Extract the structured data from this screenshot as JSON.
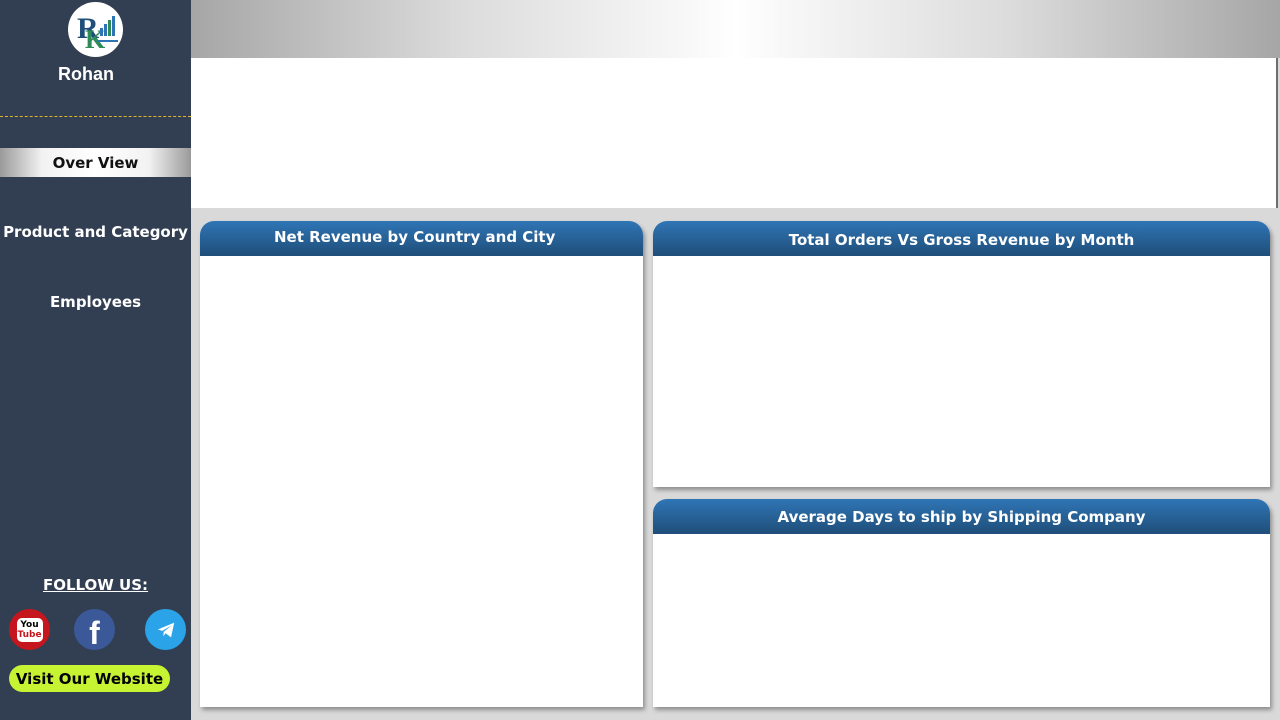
{
  "sidebar": {
    "user_name": "Rohan",
    "logo_icon": "rk-logo-icon",
    "nav": {
      "active": "Over View",
      "items": [
        "Product and Category",
        "Employees"
      ]
    },
    "follow_label": "FOLLOW US:",
    "social": {
      "youtube_line1": "You",
      "youtube_line2": "Tube",
      "facebook_glyph": "f",
      "telegram_icon": "telegram-icon"
    },
    "visit_label": "Visit Our Website"
  },
  "cards": {
    "net_revenue": {
      "title": "Net Revenue by Country and City"
    },
    "orders_vs_revenue": {
      "title": "Total Orders Vs Gross Revenue by Month"
    },
    "avg_days_ship": {
      "title": "Average Days to ship by Shipping Company"
    }
  },
  "colors": {
    "sidebar_bg": "#323e52",
    "card_header_top": "#2f75b5",
    "card_header_bottom": "#1f4e79",
    "visit_button": "#c6f433",
    "divider": "#e0b32a",
    "page_bg": "#d9d9d9"
  }
}
